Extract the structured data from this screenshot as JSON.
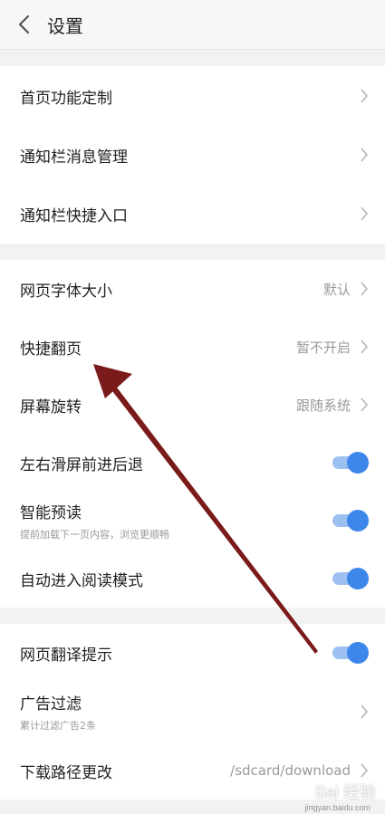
{
  "header": {
    "title": "设置",
    "back_icon": "chevron-left-icon"
  },
  "section1": [
    {
      "label": "首页功能定制"
    },
    {
      "label": "通知栏消息管理"
    },
    {
      "label": "通知栏快捷入口"
    }
  ],
  "section2": {
    "font_size": {
      "label": "网页字体大小",
      "value": "默认"
    },
    "quick_page": {
      "label": "快捷翻页",
      "value": "暂不开启"
    },
    "rotation": {
      "label": "屏幕旋转",
      "value": "跟随系统"
    },
    "swipe_nav": {
      "label": "左右滑屏前进后退",
      "enabled": true
    },
    "preread": {
      "label": "智能预读",
      "sub": "提前加载下一页内容，浏览更顺畅",
      "enabled": true
    },
    "reading_mode": {
      "label": "自动进入阅读模式",
      "enabled": true
    }
  },
  "section3": {
    "translate": {
      "label": "网页翻译提示",
      "enabled": true
    },
    "adblock": {
      "label": "广告过滤",
      "sub": "累计过滤广告2条"
    },
    "download_path": {
      "label": "下载路径更改",
      "value": "/sdcard/download"
    }
  },
  "colors": {
    "toggle_on": "#3d86ea",
    "toggle_track": "#9cc0ef",
    "arrow": "#7a1a1a"
  },
  "watermark": {
    "text": "Bai 经验",
    "sub": "jingyan.baidu.com"
  }
}
